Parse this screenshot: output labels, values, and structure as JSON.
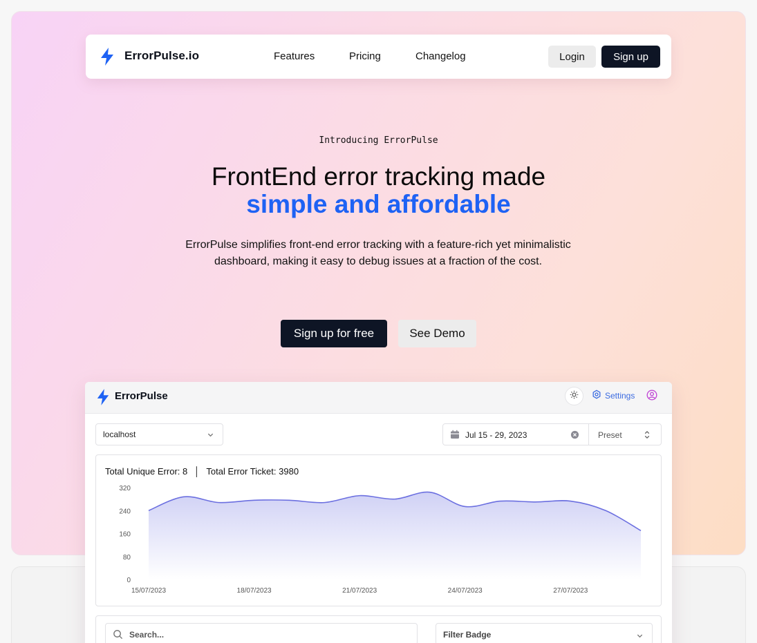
{
  "nav": {
    "brand": "ErrorPulse.io",
    "links": [
      "Features",
      "Pricing",
      "Changelog"
    ],
    "login_label": "Login",
    "signup_label": "Sign up"
  },
  "hero": {
    "intro": "Introducing ErrorPulse",
    "headline_line1": "FrontEnd error tracking made",
    "headline_line2": "simple and affordable",
    "subtext": "ErrorPulse simplifies front-end error tracking with a feature-rich yet minimalistic dashboard, making it easy to debug issues at a fraction of the cost.",
    "cta_primary": "Sign up for free",
    "cta_secondary": "See Demo"
  },
  "dashboard": {
    "brand": "ErrorPulse",
    "settings_label": "Settings",
    "site_select": "localhost",
    "date_range": "Jul 15 - 29, 2023",
    "preset_label": "Preset",
    "stats_unique": "Total Unique Error: 8",
    "stats_tickets": "Total Error Ticket: 3980",
    "search_placeholder": "Search...",
    "filter_label": "Filter Badge"
  },
  "colors": {
    "accent": "#1e62f4",
    "dark_button": "#0e1525",
    "chart_line": "#6b6fe0"
  },
  "chart_data": {
    "type": "area",
    "x": [
      "15/07/2023",
      "16/07/2023",
      "17/07/2023",
      "18/07/2023",
      "19/07/2023",
      "20/07/2023",
      "21/07/2023",
      "22/07/2023",
      "23/07/2023",
      "24/07/2023",
      "25/07/2023",
      "26/07/2023",
      "27/07/2023",
      "28/07/2023",
      "29/07/2023"
    ],
    "x_tick_labels": [
      "15/07/2023",
      "18/07/2023",
      "21/07/2023",
      "24/07/2023",
      "27/07/2023"
    ],
    "series": [
      {
        "values": [
          240,
          288,
          268,
          276,
          276,
          268,
          292,
          280,
          304,
          254,
          273,
          270,
          273,
          240,
          170
        ]
      }
    ],
    "yticks": [
      0,
      80,
      160,
      240,
      320
    ],
    "ylim": [
      0,
      320
    ],
    "grid": false,
    "legend": "none"
  }
}
